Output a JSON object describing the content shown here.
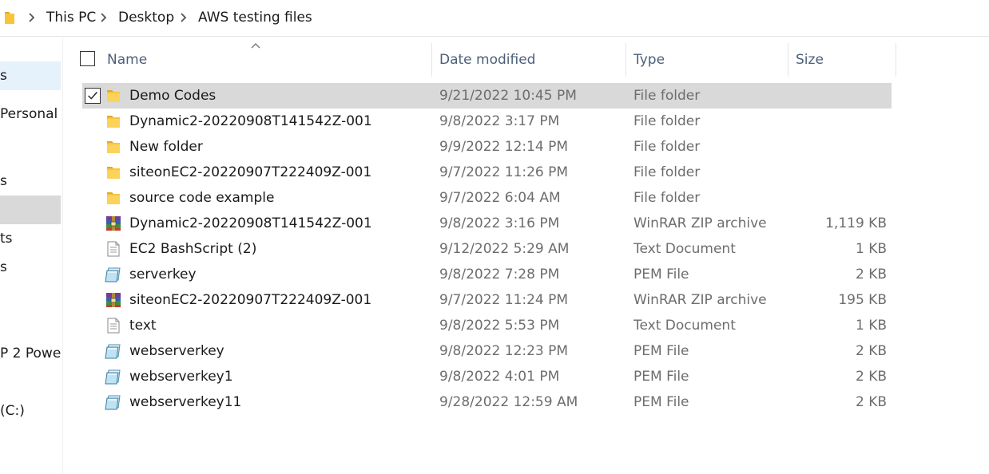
{
  "breadcrumb": [
    "This PC",
    "Desktop",
    "AWS testing files"
  ],
  "nav_items": [
    {
      "label": "s",
      "state": "light"
    },
    {
      "label": "Personal",
      "state": ""
    },
    {
      "label": "s",
      "state": ""
    },
    {
      "label": "",
      "state": "grey"
    },
    {
      "label": "ts",
      "state": ""
    },
    {
      "label": "s",
      "state": ""
    },
    {
      "label": "P 2 Powe",
      "state": ""
    },
    {
      "label": "(C:)",
      "state": ""
    }
  ],
  "columns": {
    "name": "Name",
    "date": "Date modified",
    "type": "Type",
    "size": "Size"
  },
  "colors": {
    "selected_row": "#d9d9d9",
    "nav_light": "#e5f1fb",
    "folder": "#f8c43a"
  },
  "files": [
    {
      "name": "Demo Codes",
      "date": "9/21/2022 10:45 PM",
      "type": "File folder",
      "size": "",
      "icon": "folder-icon",
      "selected": true
    },
    {
      "name": "Dynamic2-20220908T141542Z-001",
      "date": "9/8/2022 3:17 PM",
      "type": "File folder",
      "size": "",
      "icon": "folder-icon",
      "selected": false
    },
    {
      "name": "New folder",
      "date": "9/9/2022 12:14 PM",
      "type": "File folder",
      "size": "",
      "icon": "folder-icon",
      "selected": false
    },
    {
      "name": "siteonEC2-20220907T222409Z-001",
      "date": "9/7/2022 11:26 PM",
      "type": "File folder",
      "size": "",
      "icon": "folder-icon",
      "selected": false
    },
    {
      "name": "source code example",
      "date": "9/7/2022 6:04 AM",
      "type": "File folder",
      "size": "",
      "icon": "folder-icon",
      "selected": false
    },
    {
      "name": "Dynamic2-20220908T141542Z-001",
      "date": "9/8/2022 3:16 PM",
      "type": "WinRAR ZIP archive",
      "size": "1,119 KB",
      "icon": "winrar-icon",
      "selected": false
    },
    {
      "name": "EC2 BashScript (2)",
      "date": "9/12/2022 5:29 AM",
      "type": "Text Document",
      "size": "1 KB",
      "icon": "text-document-icon",
      "selected": false
    },
    {
      "name": "serverkey",
      "date": "9/8/2022 7:28 PM",
      "type": "PEM File",
      "size": "2 KB",
      "icon": "pem-file-icon",
      "selected": false
    },
    {
      "name": "siteonEC2-20220907T222409Z-001",
      "date": "9/7/2022 11:24 PM",
      "type": "WinRAR ZIP archive",
      "size": "195 KB",
      "icon": "winrar-icon",
      "selected": false
    },
    {
      "name": "text",
      "date": "9/8/2022 5:53 PM",
      "type": "Text Document",
      "size": "1 KB",
      "icon": "text-document-icon",
      "selected": false
    },
    {
      "name": "webserverkey",
      "date": "9/8/2022 12:23 PM",
      "type": "PEM File",
      "size": "2 KB",
      "icon": "pem-file-icon",
      "selected": false
    },
    {
      "name": "webserverkey1",
      "date": "9/8/2022 4:01 PM",
      "type": "PEM File",
      "size": "2 KB",
      "icon": "pem-file-icon",
      "selected": false
    },
    {
      "name": "webserverkey11",
      "date": "9/28/2022 12:59 AM",
      "type": "PEM File",
      "size": "2 KB",
      "icon": "pem-file-icon",
      "selected": false
    }
  ]
}
